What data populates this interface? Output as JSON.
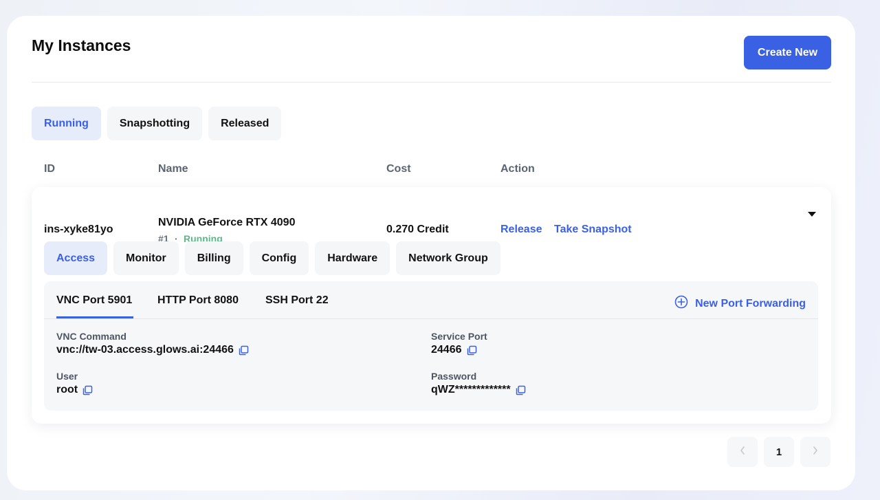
{
  "header": {
    "title": "My Instances",
    "create_label": "Create New"
  },
  "status_tabs": [
    {
      "label": "Running",
      "active": true
    },
    {
      "label": "Snapshotting",
      "active": false
    },
    {
      "label": "Released",
      "active": false
    }
  ],
  "columns": [
    "ID",
    "Name",
    "Cost",
    "Action"
  ],
  "instance": {
    "id": "ins-xyke81yo",
    "name": "NVIDIA GeForce RTX 4090",
    "index": "#1",
    "separator": "·",
    "status": "Running",
    "cost": "0.270 Credit",
    "actions": {
      "release": "Release",
      "snapshot": "Take Snapshot"
    }
  },
  "detail_tabs": [
    {
      "label": "Access",
      "active": true
    },
    {
      "label": "Monitor",
      "active": false
    },
    {
      "label": "Billing",
      "active": false
    },
    {
      "label": "Config",
      "active": false
    },
    {
      "label": "Hardware",
      "active": false
    },
    {
      "label": "Network Group",
      "active": false
    }
  ],
  "access": {
    "port_tabs": [
      "VNC Port 5901",
      "HTTP Port 8080",
      "SSH Port 22"
    ],
    "active_port_tab": "VNC Port 5901",
    "new_port_label": "New Port Forwarding",
    "fields": {
      "vnc_command": {
        "label": "VNC Command",
        "value": "vnc://tw-03.access.glows.ai:24466"
      },
      "service_port": {
        "label": "Service Port",
        "value": "24466"
      },
      "user": {
        "label": "User",
        "value": "root"
      },
      "password": {
        "label": "Password",
        "value": "qWZ*************"
      }
    }
  },
  "pagination": {
    "prev_icon": "chevron-left-icon",
    "current": "1",
    "next_icon": "chevron-right-icon"
  },
  "colors": {
    "accent": "#3a60e4",
    "running": "#5cb88a",
    "tab_active_bg": "#e7ecfb"
  }
}
